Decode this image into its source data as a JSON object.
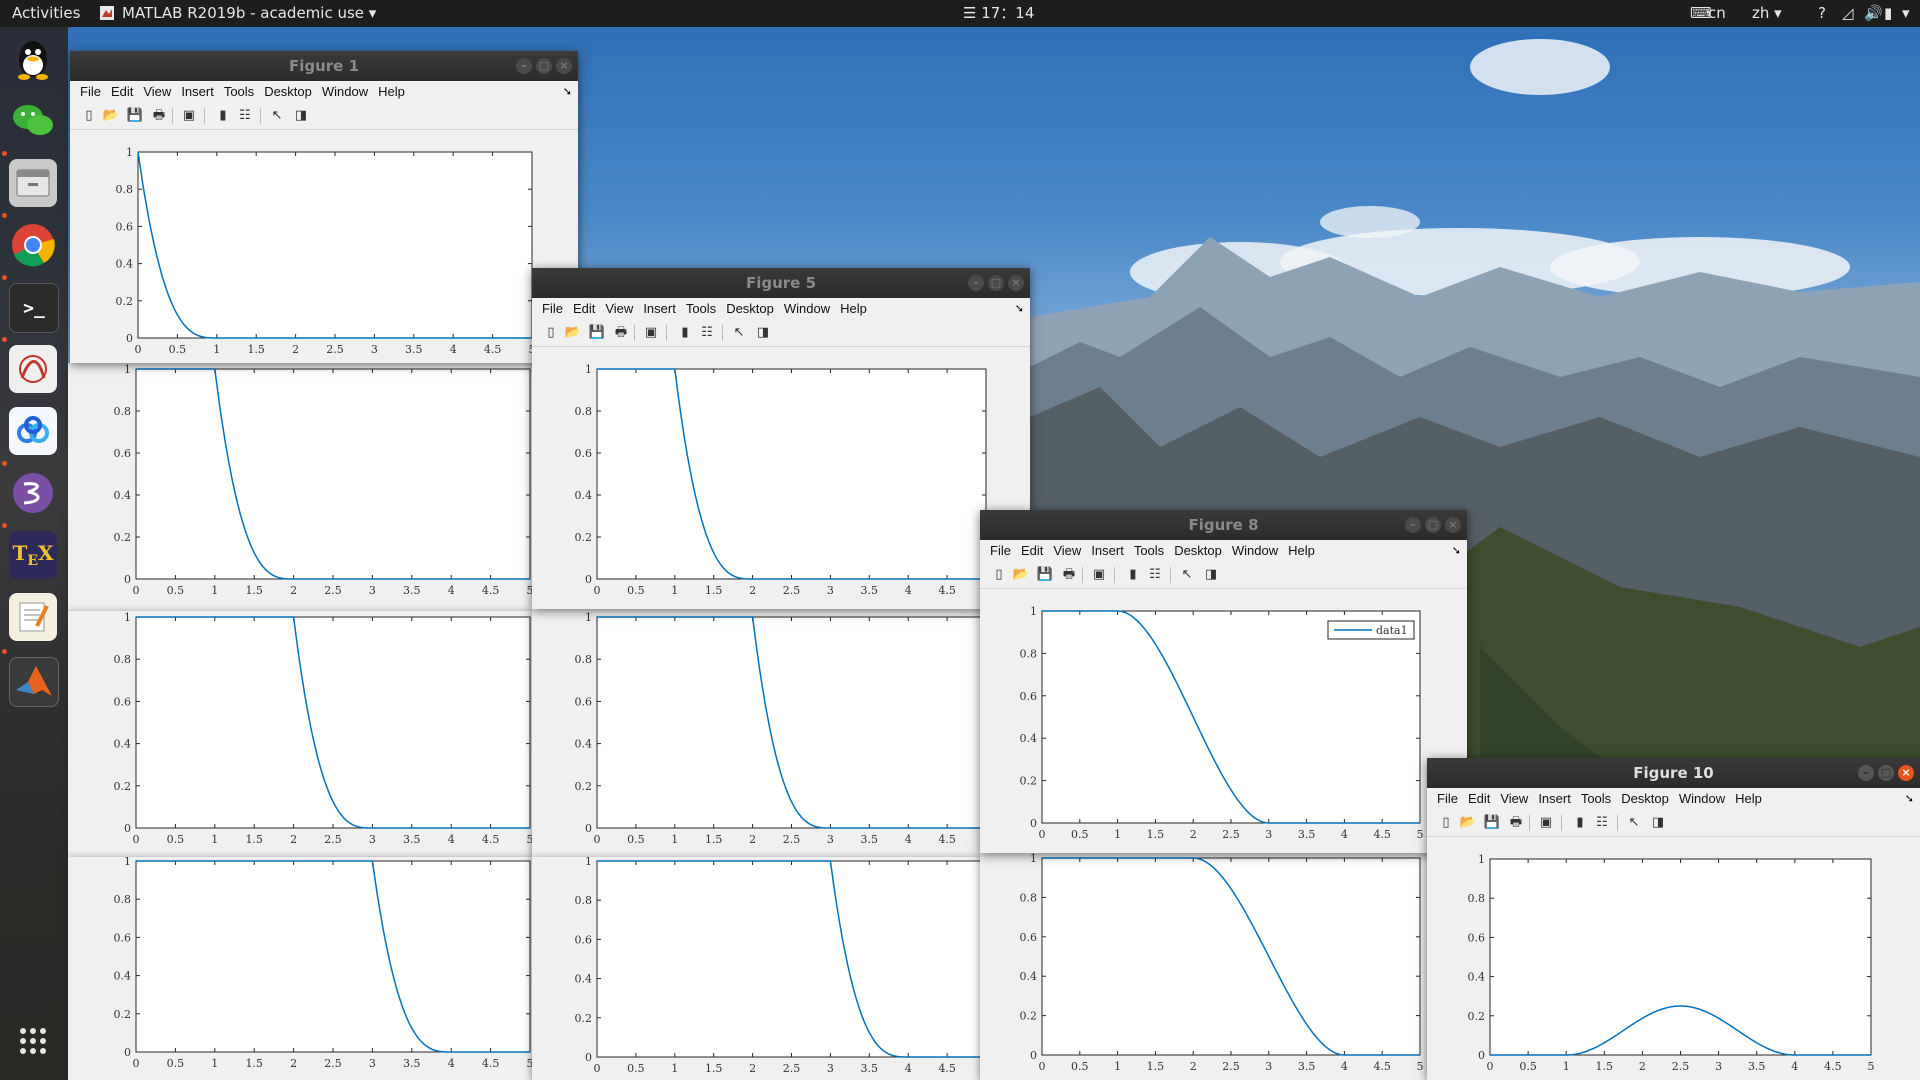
{
  "topbar": {
    "activities": "Activities",
    "app_name": "MATLAB R2019b - academic use",
    "clock": "☰ 17：14",
    "keyboard": "cn",
    "lang": "zh"
  },
  "menus": [
    "File",
    "Edit",
    "View",
    "Insert",
    "Tools",
    "Desktop",
    "Window",
    "Help"
  ],
  "windows": {
    "fig1": {
      "title": "Figure 1"
    },
    "fig5": {
      "title": "Figure 5"
    },
    "fig8": {
      "title": "Figure 8"
    },
    "fig10": {
      "title": "Figure 10"
    }
  },
  "legend_label": "data1",
  "chart_data": [
    {
      "type": "line",
      "figure": "Figure 1",
      "panel": 1,
      "x": [
        0,
        1,
        5
      ],
      "series": [
        {
          "shape": "falling-cubic",
          "from": 0,
          "to": 1
        }
      ],
      "xlim": [
        0,
        5
      ],
      "ylim": [
        0,
        1
      ],
      "xticks": [
        "0",
        "0.5",
        "1",
        "1.5",
        "2",
        "2.5",
        "3",
        "3.5",
        "4",
        "4.5",
        "5"
      ],
      "yticks": [
        "0",
        "0.2",
        "0.4",
        "0.6",
        "0.8",
        "1"
      ]
    },
    {
      "type": "line",
      "figure": "Figure 1",
      "panel": 2,
      "series": [
        {
          "from": 1,
          "to": 2
        }
      ],
      "xlim": [
        0,
        5
      ],
      "ylim": [
        0,
        1
      ]
    },
    {
      "type": "line",
      "figure": "Figure 1",
      "panel": 3,
      "series": [
        {
          "from": 2,
          "to": 3
        }
      ],
      "xlim": [
        0,
        5
      ],
      "ylim": [
        0,
        1
      ]
    },
    {
      "type": "line",
      "figure": "Figure 1",
      "panel": 4,
      "series": [
        {
          "from": 3,
          "to": 4
        }
      ],
      "xlim": [
        0,
        5
      ],
      "ylim": [
        0,
        1
      ]
    },
    {
      "type": "line",
      "figure": "Figure 5",
      "panel": 1,
      "series": [
        {
          "from": 1,
          "to": 2
        }
      ],
      "xlim": [
        0,
        5
      ],
      "ylim": [
        0,
        1
      ]
    },
    {
      "type": "line",
      "figure": "Figure 5",
      "panel": 2,
      "series": [
        {
          "from": 2,
          "to": 3
        }
      ],
      "xlim": [
        0,
        5
      ],
      "ylim": [
        0,
        1
      ]
    },
    {
      "type": "line",
      "figure": "Figure 5",
      "panel": 3,
      "series": [
        {
          "from": 3,
          "to": 4
        }
      ],
      "xlim": [
        0,
        5
      ],
      "ylim": [
        0,
        1
      ]
    },
    {
      "type": "line",
      "figure": "Figure 8",
      "panel": 1,
      "series": [
        {
          "name": "data1",
          "shape": "smooth-step-down",
          "from": 1,
          "to": 3
        }
      ],
      "xlim": [
        0,
        5
      ],
      "ylim": [
        0,
        1
      ],
      "legend": "top-right"
    },
    {
      "type": "line",
      "figure": "Figure 8",
      "panel": 2,
      "series": [
        {
          "shape": "smooth-step-down",
          "from": 2,
          "to": 4
        }
      ],
      "xlim": [
        0,
        5
      ],
      "ylim": [
        0,
        1
      ]
    },
    {
      "type": "line",
      "figure": "Figure 10",
      "panel": 1,
      "series": [
        {
          "shape": "bump",
          "from": 1,
          "to": 4,
          "peak_x": 2.5,
          "peak_y": 0.25
        }
      ],
      "xlim": [
        0,
        5
      ],
      "ylim": [
        0,
        1
      ]
    }
  ]
}
